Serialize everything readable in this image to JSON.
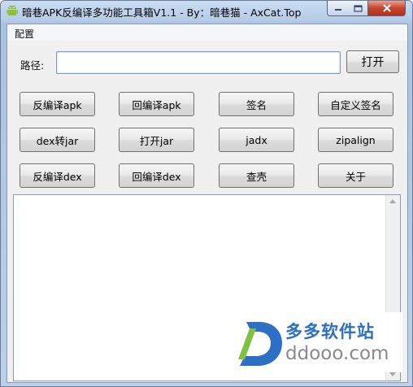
{
  "window": {
    "title": "暗巷APK反编译多功能工具箱V1.1 - By：暗巷猫 - AxCat.Top"
  },
  "menubar": {
    "items": [
      {
        "label": "配置"
      }
    ]
  },
  "path": {
    "label": "路径:",
    "value": "",
    "placeholder": "",
    "open_button": "打开"
  },
  "buttons": [
    {
      "label": "反编译apk"
    },
    {
      "label": "回编译apk"
    },
    {
      "label": "签名"
    },
    {
      "label": "自定义签名"
    },
    {
      "label": "dex转jar"
    },
    {
      "label": "打开jar"
    },
    {
      "label": "jadx"
    },
    {
      "label": "zipalign"
    },
    {
      "label": "反编译dex"
    },
    {
      "label": "回编译dex"
    },
    {
      "label": "查壳"
    },
    {
      "label": "关于"
    }
  ],
  "output": {
    "text": ""
  },
  "watermark": {
    "name": "多多软件站",
    "domain": "ddooo.com"
  },
  "colors": {
    "title_bar": "#b7cde8",
    "close_button": "#c7432e",
    "client_bg": "#f0f0f0",
    "watermark_blue": "#2c6fc4"
  },
  "icons": [
    "android-app-icon",
    "minimize-icon",
    "maximize-icon",
    "close-icon",
    "scroll-up-icon",
    "scroll-down-icon"
  ]
}
